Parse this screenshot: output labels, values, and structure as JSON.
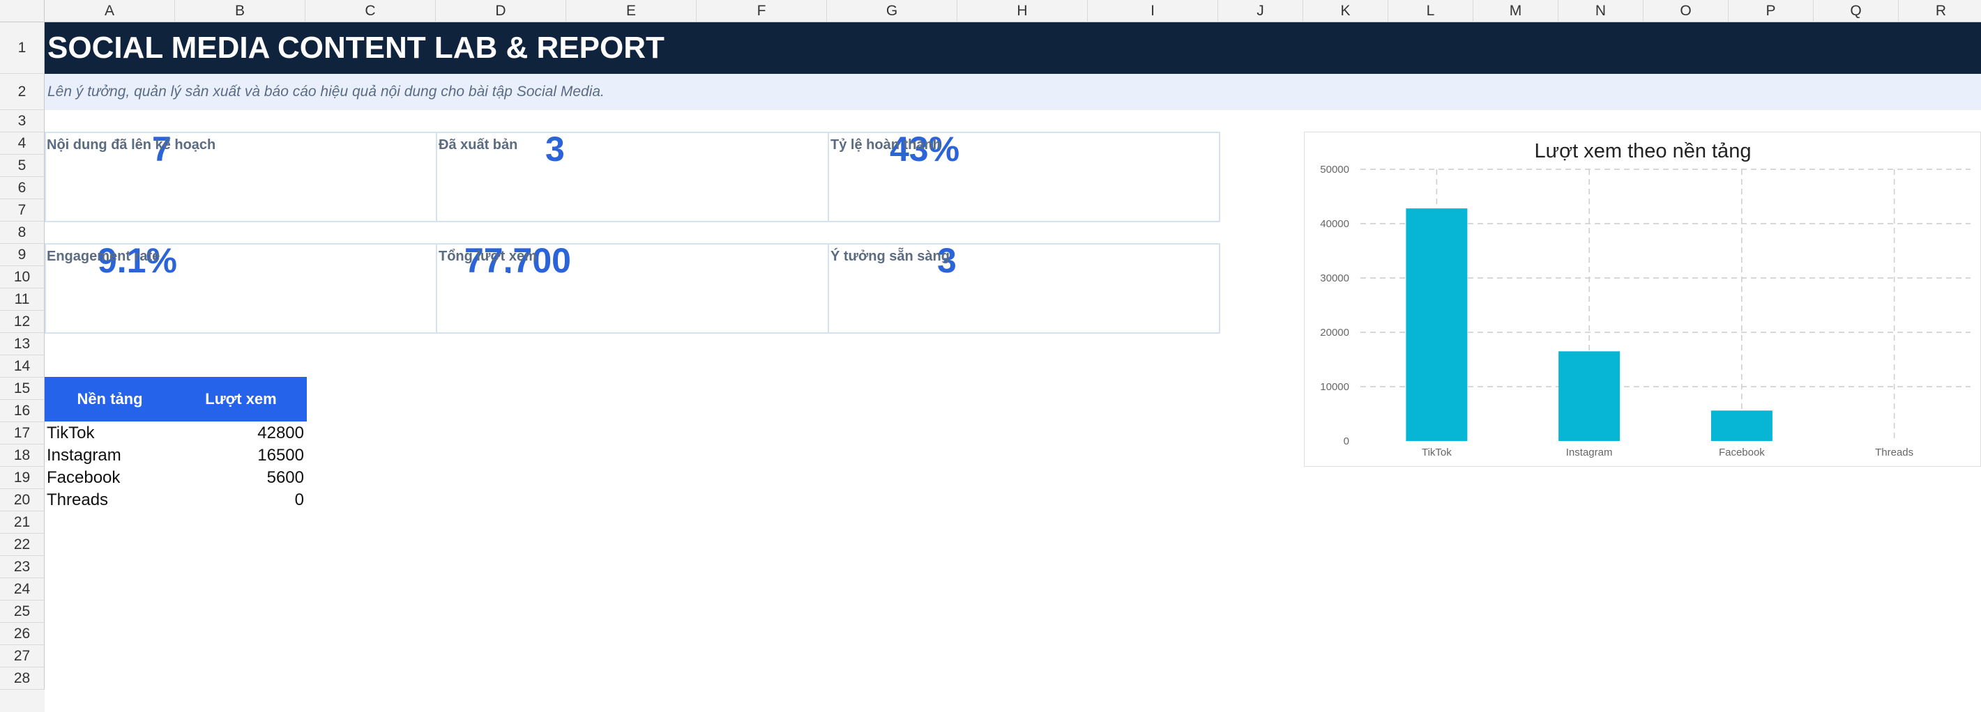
{
  "columns": [
    "A",
    "B",
    "C",
    "D",
    "E",
    "F",
    "G",
    "H",
    "I",
    "J",
    "K",
    "L",
    "M",
    "N",
    "O",
    "P",
    "Q",
    "R"
  ],
  "rows": [
    "1",
    "2",
    "3",
    "4",
    "5",
    "6",
    "7",
    "8",
    "9",
    "10",
    "11",
    "12",
    "13",
    "14",
    "15",
    "16",
    "17",
    "18",
    "19",
    "20",
    "21",
    "22",
    "23",
    "24",
    "25",
    "26",
    "27",
    "28"
  ],
  "title": "SOCIAL MEDIA CONTENT LAB & REPORT",
  "subtitle": "Lên ý tưởng, quản lý sản xuất và báo cáo hiệu quả nội dung cho bài tập Social Media.",
  "kpis": [
    {
      "label": "Nội dung đã lên kế hoạch",
      "value": "7"
    },
    {
      "label": "Đã xuất bản",
      "value": "3"
    },
    {
      "label": "Tỷ lệ hoàn thành",
      "value": "43%"
    },
    {
      "label": "Engagement rate",
      "value": "9.1%"
    },
    {
      "label": "Tổng lượt xem",
      "value": "77,700"
    },
    {
      "label": "Ý tưởng sẵn sàng",
      "value": "3"
    }
  ],
  "table": {
    "headers": [
      "Nền tảng",
      "Lượt xem"
    ],
    "rows": [
      {
        "platform": "TikTok",
        "views": "42800"
      },
      {
        "platform": "Instagram",
        "views": "16500"
      },
      {
        "platform": "Facebook",
        "views": "5600"
      },
      {
        "platform": "Threads",
        "views": "0"
      }
    ]
  },
  "colors": {
    "title_bg": "#10233d",
    "subtitle_bg": "#e9f0fc",
    "accent": "#2b63d8",
    "table_header": "#2563eb",
    "bar": "#06b6d4"
  },
  "chart_data": {
    "type": "bar",
    "title": "Lượt xem theo nền tảng",
    "categories": [
      "TikTok",
      "Instagram",
      "Facebook",
      "Threads"
    ],
    "values": [
      42800,
      16500,
      5600,
      0
    ],
    "ylim": [
      0,
      50000
    ],
    "yticks": [
      "0",
      "10000",
      "20000",
      "30000",
      "40000",
      "50000"
    ],
    "grid": true,
    "legend": "none"
  }
}
